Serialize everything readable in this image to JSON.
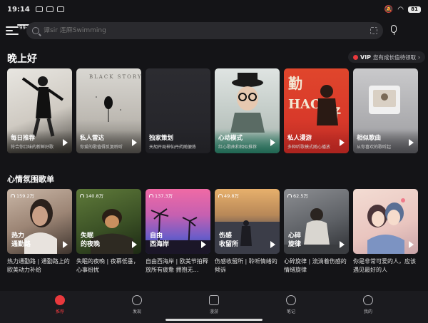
{
  "status_bar": {
    "time": "19:14",
    "battery": "81"
  },
  "search": {
    "placeholder": "谭sir 连麻Swimming"
  },
  "menu": {
    "badge": "99+"
  },
  "greeting": "晚上好",
  "vip_chip": {
    "vip": "VIP",
    "text": "您有成长值待领取",
    "arrow": "›"
  },
  "recommend_cards": [
    {
      "title": "每日推荐",
      "subtitle": "符合你口味的新鲜好歌"
    },
    {
      "title": "私人雷达",
      "subtitle": "你爱的歌值得反复聆听"
    },
    {
      "title": "独家策划",
      "subtitle": "天胡开局神仙丹药随便炼"
    },
    {
      "title": "心动模式",
      "subtitle": "红心歌曲和相似推荐"
    },
    {
      "title": "私人漫游",
      "subtitle": "多种听歌模式随心播放"
    },
    {
      "title": "相似歌曲",
      "subtitle": "从你喜欢的歌听起"
    }
  ],
  "mood_section": {
    "title": "心情氛围歌单"
  },
  "playlists": [
    {
      "count": "159.2万",
      "label": "热力\n通勤路",
      "desc": "热力通勤路 | 通勤路上的欧美动力补给"
    },
    {
      "count": "140.8万",
      "label": "失眠\n的夜晚",
      "desc": "失眠的夜晚 | 夜幕低垂，心事纷扰"
    },
    {
      "count": "137.3万",
      "label": "自由\n西海岸",
      "desc": "自由西海岸 | 欧美节拍释放所有疲惫 拥抱无…"
    },
    {
      "count": "49.8万",
      "label": "伤感\n收留所",
      "desc": "伤感收留所 | 聆听情绪的倾诉"
    },
    {
      "count": "62.5万",
      "label": "心碎\n旋律",
      "desc": "心碎旋律 | 流淌着伤感的情绪旋律"
    },
    {
      "count": "",
      "label": "",
      "desc": "你是非常可爱的人，应该遇见最好的人"
    }
  ],
  "nav": [
    {
      "label": "推荐"
    },
    {
      "label": "发现"
    },
    {
      "label": "漫游"
    },
    {
      "label": "笔记"
    },
    {
      "label": "我的"
    }
  ],
  "colors": {
    "accent": "#e9393d",
    "background": "#141417"
  }
}
